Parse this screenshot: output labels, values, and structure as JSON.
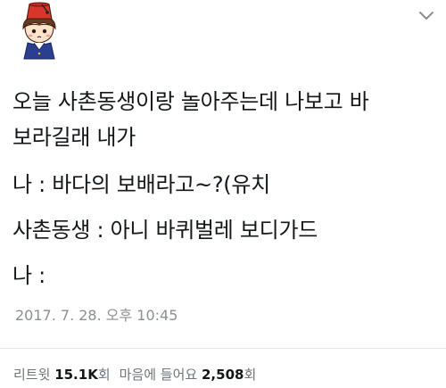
{
  "tweet": {
    "lines": [
      "오늘 사촌동생이랑 놀아주는데 나보고 바",
      "보라길래 내가",
      "나 : 바다의 보배라고~?(유치",
      "사촌동생 : 아니 바퀴벌레 보디가드",
      "나 :"
    ],
    "timestamp": "2017. 7. 28. 오후 10:45"
  },
  "stats": {
    "retweet_label": "리트윗",
    "retweet_count": "15.1K",
    "retweet_unit": "회",
    "like_label": "마음에 들어요",
    "like_count": "2,508",
    "like_unit": "회"
  },
  "icons": {
    "avatar": "cartoon-avatar-red-fez",
    "menu": "chevron-down-icon"
  },
  "colors": {
    "text": "#14171a",
    "muted": "#8a8f94",
    "divider": "#e1e8ed",
    "fez": "#d9362b"
  }
}
